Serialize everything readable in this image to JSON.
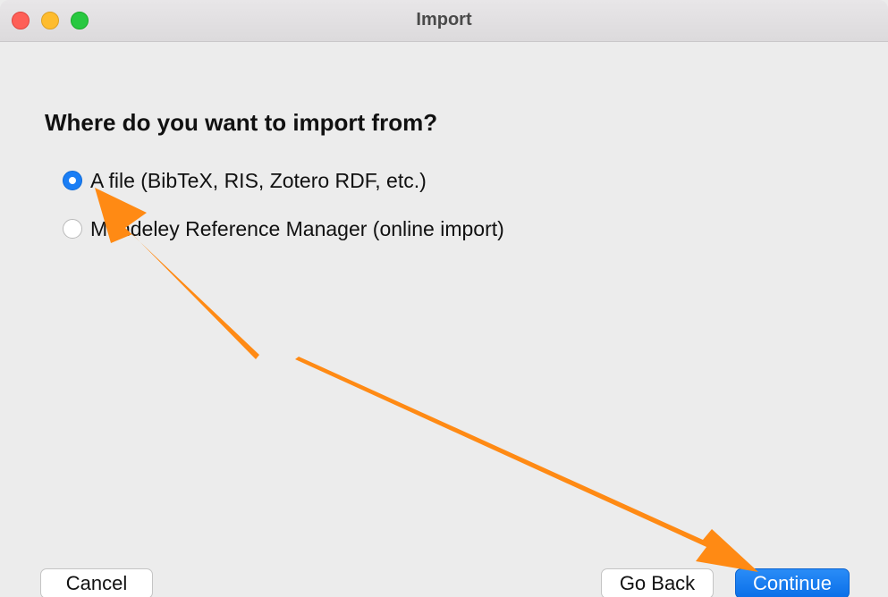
{
  "window": {
    "title": "Import"
  },
  "dialog": {
    "question": "Where do you want to import from?",
    "options": [
      {
        "label": "A file (BibTeX, RIS, Zotero RDF, etc.)",
        "selected": true
      },
      {
        "label": "Mendeley Reference Manager (online import)",
        "selected": false
      }
    ]
  },
  "buttons": {
    "cancel": "Cancel",
    "go_back": "Go Back",
    "continue": "Continue"
  },
  "colors": {
    "accent": "#1a7ef5",
    "annotation_arrow": "#ff8a14"
  },
  "icons": {
    "close": "traffic-light-close-icon",
    "minimize": "traffic-light-minimize-icon",
    "maximize": "traffic-light-maximize-icon"
  }
}
